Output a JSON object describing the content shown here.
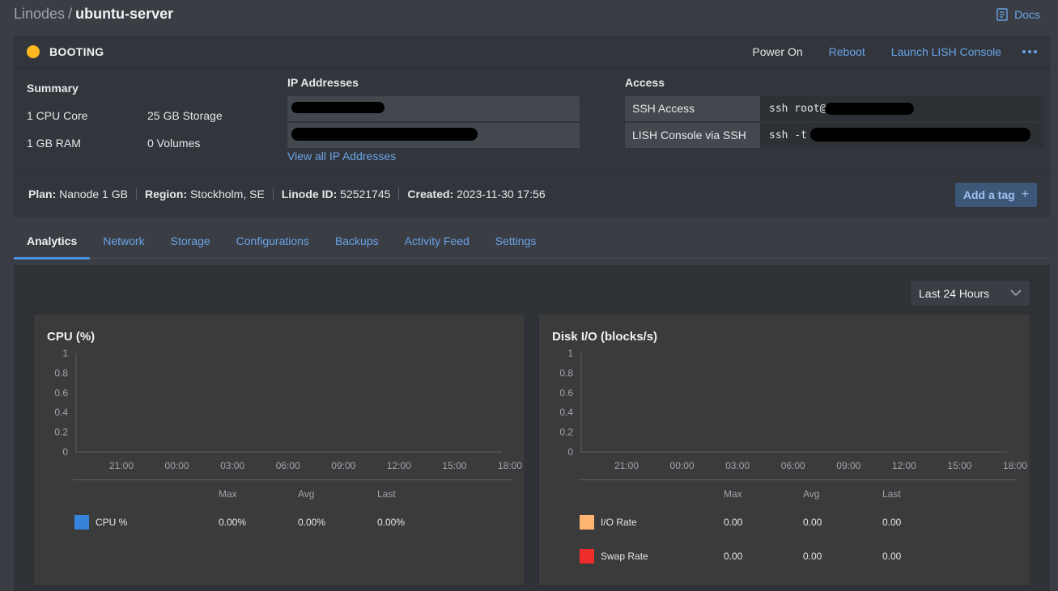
{
  "breadcrumb": {
    "root": "Linodes",
    "sep": "/",
    "current": "ubuntu-server"
  },
  "docs": {
    "label": "Docs"
  },
  "status": {
    "text": "BOOTING",
    "color": "#fdb822"
  },
  "actions": {
    "power_on": "Power On",
    "reboot": "Reboot",
    "lish": "Launch LISH Console"
  },
  "summary": {
    "title": "Summary",
    "cpu": "1 CPU Core",
    "storage": "25 GB Storage",
    "ram": "1 GB RAM",
    "volumes": "0 Volumes"
  },
  "ip": {
    "title": "IP Addresses",
    "view_all": "View all IP Addresses"
  },
  "access": {
    "title": "Access",
    "rows": [
      {
        "label": "SSH Access",
        "value": "ssh root@"
      },
      {
        "label": "LISH Console via SSH",
        "value": "ssh -t"
      }
    ]
  },
  "meta": {
    "plan_key": "Plan:",
    "plan_val": "Nanode 1 GB",
    "region_key": "Region:",
    "region_val": "Stockholm, SE",
    "id_key": "Linode ID:",
    "id_val": "52521745",
    "created_key": "Created:",
    "created_val": "2023-11-30 17:56",
    "tag_label": "Add a tag",
    "tag_icon": "+"
  },
  "tabs": [
    "Analytics",
    "Network",
    "Storage",
    "Configurations",
    "Backups",
    "Activity Feed",
    "Settings"
  ],
  "range": {
    "selected": "Last 24 Hours"
  },
  "legend_headers": {
    "max": "Max",
    "avg": "Avg",
    "last": "Last"
  },
  "chart_data": [
    {
      "type": "line",
      "title": "CPU (%)",
      "x": [
        "21:00",
        "00:00",
        "03:00",
        "06:00",
        "09:00",
        "12:00",
        "15:00",
        "18:00"
      ],
      "y_ticks": [
        "1",
        "0.8",
        "0.6",
        "0.4",
        "0.2",
        "0"
      ],
      "ylim": [
        0,
        1
      ],
      "grid": false,
      "series": [
        {
          "name": "CPU %",
          "color": "#3683dc",
          "values": [],
          "max": "0.00%",
          "avg": "0.00%",
          "last": "0.00%"
        }
      ]
    },
    {
      "type": "line",
      "title": "Disk I/O (blocks/s)",
      "x": [
        "21:00",
        "00:00",
        "03:00",
        "06:00",
        "09:00",
        "12:00",
        "15:00",
        "18:00"
      ],
      "y_ticks": [
        "1",
        "0.8",
        "0.6",
        "0.4",
        "0.2",
        "0"
      ],
      "ylim": [
        0,
        1
      ],
      "grid": false,
      "series": [
        {
          "name": "I/O Rate",
          "color": "#ffb470",
          "values": [],
          "max": "0.00",
          "avg": "0.00",
          "last": "0.00"
        },
        {
          "name": "Swap Rate",
          "color": "#ee2c2c",
          "values": [],
          "max": "0.00",
          "avg": "0.00",
          "last": "0.00"
        }
      ]
    }
  ]
}
